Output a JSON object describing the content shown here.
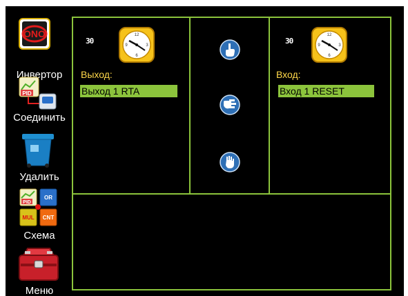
{
  "toolbar": {
    "inverter": {
      "label": "Инвертор",
      "icon_text": "ONO"
    },
    "connect": {
      "label": "Соединить",
      "icon_text": "PID"
    },
    "delete": {
      "label": "Удалить"
    },
    "scheme": {
      "label": "Схема",
      "blocks": [
        "PID",
        "OR",
        "MUL",
        "CNT"
      ]
    },
    "menu": {
      "label": "Меню"
    }
  },
  "output_panel": {
    "timer_value": "30",
    "caption": "Выход:",
    "selected": "Выход 1  RTA"
  },
  "input_panel": {
    "timer_value": "30",
    "caption": "Вход:",
    "selected": "Вход 1  RESET"
  },
  "colors": {
    "accent_green": "#8cc43c",
    "caption_yellow": "#ffd84a",
    "button_blue": "#2e6fb5"
  },
  "icons": [
    "inverter-icon",
    "connect-icon",
    "trash-bin-icon",
    "scheme-icon",
    "toolbox-icon",
    "clock-icon",
    "hand-pointing-up-icon",
    "hand-pointing-right-icon",
    "hand-stop-icon"
  ]
}
